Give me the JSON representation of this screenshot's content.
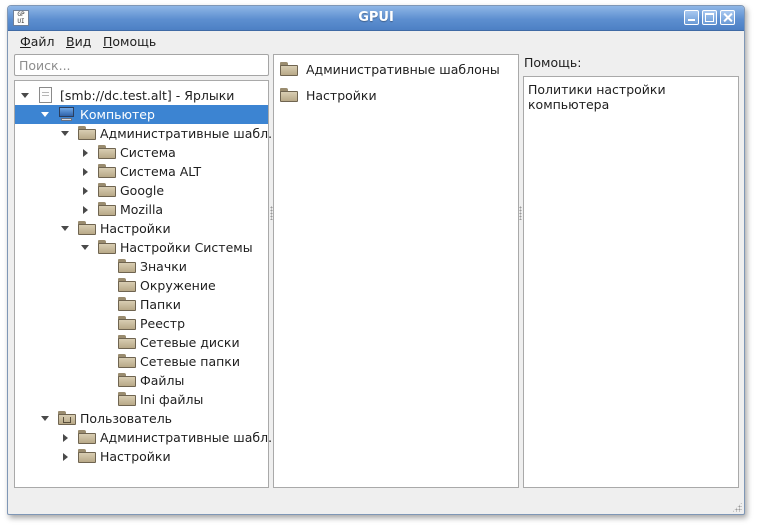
{
  "window": {
    "title": "GPUI",
    "app_icon_text": "GP UI"
  },
  "menu": {
    "file_u": "Ф",
    "file_rest": "айл",
    "view_u": "В",
    "view_rest": "ид",
    "help_u": "П",
    "help_rest": "омощь"
  },
  "search": {
    "placeholder": "Поиск..."
  },
  "tree": {
    "root": "[smb://dc.test.alt] - Ярлыки",
    "computer": "Компьютер",
    "admin_templates": "Административные шабл...",
    "sistema": "Система",
    "sistema_alt": "Система ALT",
    "google": "Google",
    "mozilla": "Mozilla",
    "settings": "Настройки",
    "system_settings": "Настройки Системы",
    "icons": "Значки",
    "environment": "Окружение",
    "folders": "Папки",
    "registry": "Реестр",
    "network_drives": "Сетевые диски",
    "network_folders": "Сетевые папки",
    "files": "Файлы",
    "ini_files": "Ini файлы",
    "user": "Пользователь",
    "user_admin_templates": "Административные шабл...",
    "user_settings": "Настройки"
  },
  "content_list": [
    "Административные шаблоны",
    "Настройки"
  ],
  "help": {
    "label": "Помощь:",
    "text": "Политики настройки компьютера"
  }
}
